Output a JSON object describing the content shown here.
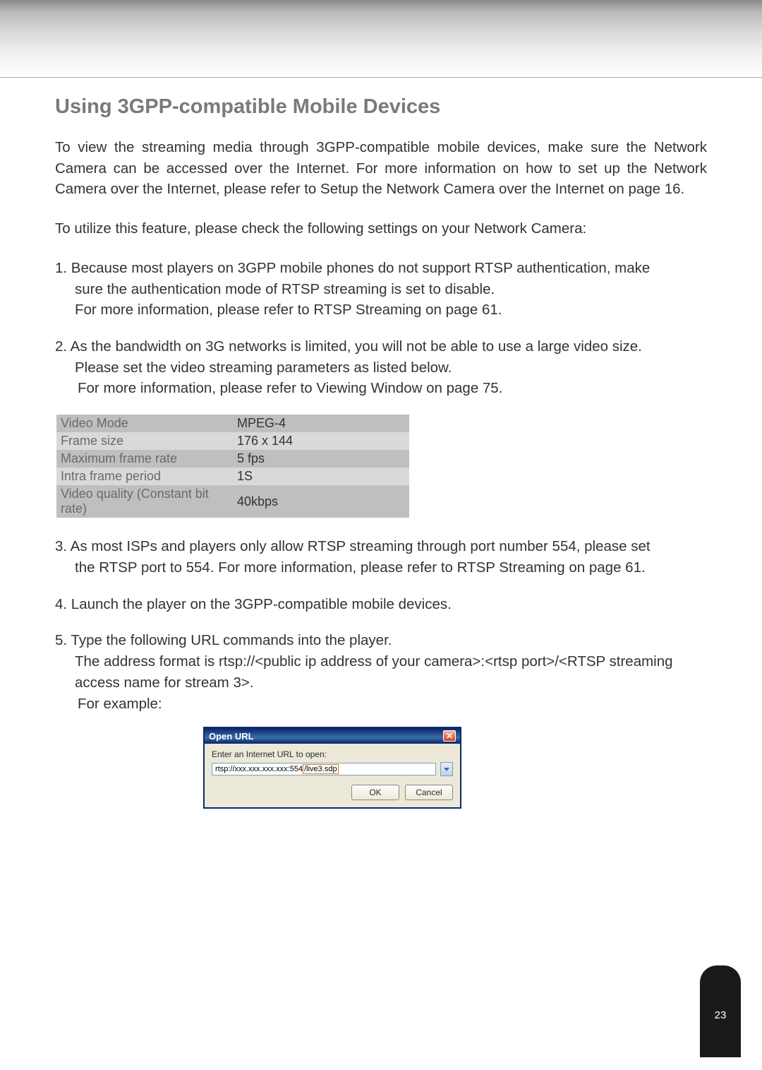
{
  "heading": "Using 3GPP-compatible Mobile Devices",
  "intro": "To view the streaming media through 3GPP-compatible mobile devices, make sure the Network Camera can be accessed over the Internet. For more information on how to set up the Network Camera over the Internet, please refer to Setup the Network Camera over the Internet on page 16.",
  "checkline": "To utilize this feature, please check the following settings on your Network Camera:",
  "item1_l1": "1. Because most players on 3GPP mobile phones do not support RTSP authentication, make",
  "item1_l2": "sure the authentication mode of RTSP streaming is set to disable.",
  "item1_l3": "For more information, please refer to RTSP Streaming on page 61.",
  "item2_l1": "2. As the bandwidth on 3G networks is limited, you will not be able to use a large video size.",
  "item2_l2": "Please set the video streaming parameters as listed below.",
  "item2_l3": "For more information, please refer to Viewing Window on page 75.",
  "settings": {
    "rows": [
      {
        "label": "Video Mode",
        "value": "MPEG-4"
      },
      {
        "label": "Frame size",
        "value": "176 x 144"
      },
      {
        "label": "Maximum frame rate",
        "value": "5 fps"
      },
      {
        "label": "Intra frame period",
        "value": "1S"
      },
      {
        "label": "Video quality (Constant bit rate)",
        "value": "40kbps"
      }
    ]
  },
  "item3_l1": "3. As most ISPs and players only allow RTSP streaming through port number 554, please set",
  "item3_l2": "the RTSP port to 554. For more information, please refer to RTSP Streaming on page 61.",
  "item4": "4. Launch the player on the 3GPP-compatible mobile devices.",
  "item5_l1": "5. Type the following URL commands into the player.",
  "item5_l2": "The address format is rtsp://<public ip address of your camera>:<rtsp port>/<RTSP streaming",
  "item5_l3": "access name for stream 3>.",
  "item5_l4": "For example:",
  "dialog": {
    "title": "Open URL",
    "label": "Enter an Internet URL to open:",
    "url_prefix": "rtsp://xxx.xxx.xxx.xxx:554",
    "url_suffix": "/live3.sdp",
    "ok": "OK",
    "cancel": "Cancel",
    "close": "✕"
  },
  "page_number": "23"
}
